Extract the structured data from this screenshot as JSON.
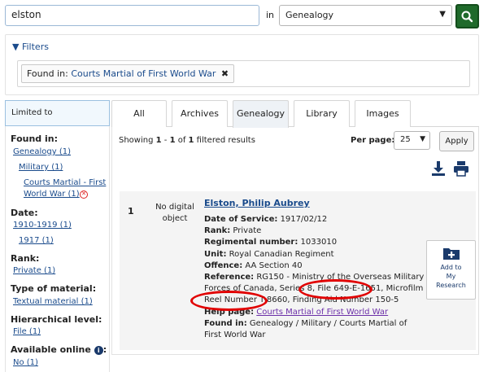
{
  "search": {
    "value": "elston",
    "in_label": "in",
    "scope": "Genealogy"
  },
  "filters": {
    "heading": "Filters",
    "chip_label": "Found in:",
    "chip_value": "Courts Martial of First World War"
  },
  "sidebar": {
    "limited_to": "Limited to",
    "found_in": "Found in:",
    "genealogy": "Genealogy (1)",
    "military": "Military (1)",
    "courts_martial_line1": "Courts Martial - First",
    "courts_martial_line2": "World War (1)",
    "date": "Date:",
    "decade": "1910-1919 (1)",
    "year": "1917 (1)",
    "rank": "Rank:",
    "rank_value": "Private (1)",
    "type_of_material": "Type of material:",
    "type_value": "Textual material (1)",
    "hierarchical_level": "Hierarchical level:",
    "hier_value": "File (1)",
    "available_online": "Available online",
    "online_value": "No (1)"
  },
  "tabs": [
    {
      "label": "All"
    },
    {
      "label": "Archives"
    },
    {
      "label": "Genealogy"
    },
    {
      "label": "Library"
    },
    {
      "label": "Images"
    }
  ],
  "results": {
    "showing_prefix": "Showing ",
    "showing_from": "1",
    "showing_mid": " - ",
    "showing_to": "1",
    "showing_of": " of ",
    "showing_total": "1",
    "showing_suffix": " filtered results",
    "per_page_label": "Per page:",
    "per_page_value": "25",
    "apply": "Apply"
  },
  "record": {
    "number": "1",
    "no_digital": "No digital object",
    "title": "Elston, Philip Aubrey",
    "date_label": "Date of Service:",
    "date_value": "1917/02/12",
    "rank_label": "Rank:",
    "rank_value": "Private",
    "regnum_label": "Regimental number:",
    "regnum_value": "1033010",
    "unit_label": "Unit:",
    "unit_value": "Royal Canadian Regiment",
    "offence_label": "Offence:",
    "offence_value": "AA Section 40",
    "reference_label": "Reference:",
    "reference_value": "RG150 - Ministry of the Overseas Military Forces of Canada, Series 8, File 649-E-1651, Microfilm Reel Number T-8660, Finding Aid Number 150-5",
    "help_label": "Help page:",
    "help_value": "Courts Martial of First World War",
    "found_label": "Found in:",
    "found_value": "Genealogy / Military / Courts Martial of First World War",
    "add_line1": "Add to",
    "add_line2": "My",
    "add_line3": "Research"
  },
  "colors": {
    "accent": "#1f6a2b",
    "link": "#1a4b8c",
    "highlight": "#e10000"
  }
}
